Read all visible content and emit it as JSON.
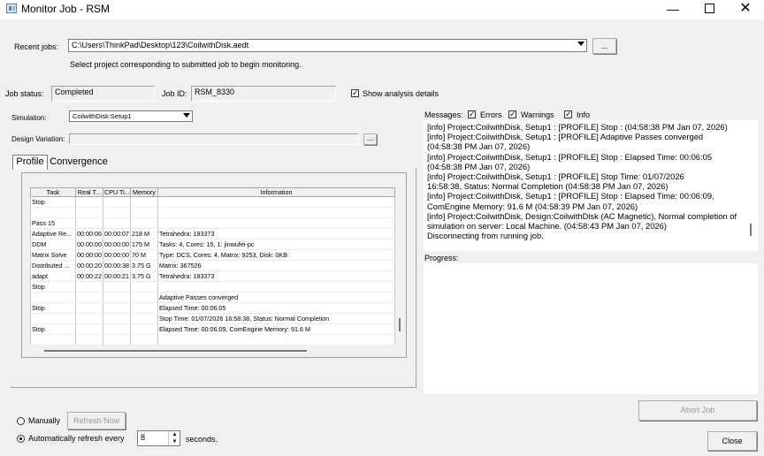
{
  "window": {
    "title": "Monitor Job - RSM",
    "min_glyph": "—",
    "close_glyph": "✕"
  },
  "recent_jobs": {
    "label": "Recent jobs:",
    "value": "C:\\Users\\ThinkPad\\Desktop\\123\\CoilwithDisk.aedt",
    "browse_label": "...",
    "hint": "Select project corresponding to submitted job to begin monitoring."
  },
  "job_status": {
    "label": "Job status:",
    "value": "Completed"
  },
  "job_id": {
    "label": "Job ID:",
    "value": "RSM_8330"
  },
  "show_details": {
    "label": "Show analysis details",
    "checked": true
  },
  "simulation": {
    "label": "Simulation:",
    "value": "CoilwithDisk:Setup1"
  },
  "design_variation": {
    "label": "Design Variation:",
    "value": "",
    "browse_label": "..."
  },
  "tabs": [
    {
      "label": "Profile",
      "active": true
    },
    {
      "label": "Convergence",
      "active": false
    }
  ],
  "profile_table": {
    "columns": [
      "Task",
      "Real T...",
      "CPU Ti...",
      "Memory",
      "Information"
    ],
    "rows": [
      [
        "Stop",
        "",
        "",
        "",
        ""
      ],
      [
        "",
        "",
        "",
        "",
        ""
      ],
      [
        "Pass 15",
        "",
        "",
        "",
        ""
      ],
      [
        "Adaptive Re...",
        "00:00:06",
        "00:00:07",
        "218 M",
        "Tetrahedra: 193373"
      ],
      [
        "DDM",
        "00:00:00",
        "00:00:00",
        "175 M",
        "Tasks: 4, Cores: 15, 1: jinwufei-pc"
      ],
      [
        "Matrix Solve",
        "00:00:00",
        "00:00:00",
        "70 M",
        "Type: DCS, Cores: 4, Matrix: 9253, Disk: 0KB"
      ],
      [
        "Distributed ...",
        "00:00:20",
        "00:00:38",
        "3.75 G",
        "Matrix: 367526"
      ],
      [
        "adapt",
        "00:00:22",
        "00:00:21",
        "3.75 G",
        "Tetrahedra: 193373"
      ],
      [
        "Stop",
        "",
        "",
        "",
        ""
      ],
      [
        "",
        "",
        "",
        "",
        "Adaptive Passes converged"
      ],
      [
        "Stop",
        "",
        "",
        "",
        "Elapsed Time: 00:06:05"
      ],
      [
        "",
        "",
        "",
        "",
        "Stop Time: 01/07/2026 16:58:38, Status: Normal Completion"
      ],
      [
        "Stop",
        "",
        "",
        "",
        "Elapsed Time: 00:06:09, ComEngine Memory: 91.6 M"
      ],
      [
        "",
        "",
        "",
        "",
        ""
      ]
    ]
  },
  "messages": {
    "label": "Messages:",
    "filters": [
      {
        "label": "Errors",
        "checked": true
      },
      {
        "label": "Warnings",
        "checked": true
      },
      {
        "label": "Info",
        "checked": true
      }
    ],
    "lines": [
      "[info] Project:CoilwithDisk, Setup1 : [PROFILE] Stop :   (04:58:38 PM  Jan 07, 2026)",
      "[info] Project:CoilwithDisk, Setup1 : [PROFILE]        Adaptive Passes converged",
      "(04:58:38 PM  Jan 07, 2026)",
      "[info] Project:CoilwithDisk, Setup1 : [PROFILE] Stop : Elapsed Time: 00:06:05",
      "(04:58:38 PM  Jan 07, 2026)",
      "[info] Project:CoilwithDisk, Setup1 : [PROFILE]        Stop Time: 01/07/2026",
      "16:58:38, Status: Normal Completion (04:58:38 PM  Jan 07, 2026)",
      "[info] Project:CoilwithDisk, Setup1 : [PROFILE] Stop : Elapsed Time: 00:06:09,",
      "ComEngine Memory: 91.6 M (04:58:39 PM  Jan 07, 2026)",
      "[info] Project:CoilwithDisk, Design:CoilwithDisk (AC Magnetic), Normal completion of",
      "simulation on server: Local Machine. (04:58:43 PM  Jan 07, 2026)",
      "Disconnecting from running job."
    ]
  },
  "progress": {
    "label": "Progress:"
  },
  "refresh": {
    "manual_label": "Manually",
    "refresh_now_label": "Refresh Now",
    "auto_label": "Automatically refresh every",
    "interval": "8",
    "seconds_label": "seconds.",
    "mode": "automatic"
  },
  "abort_label": "Abort Job",
  "close_label": "Close"
}
